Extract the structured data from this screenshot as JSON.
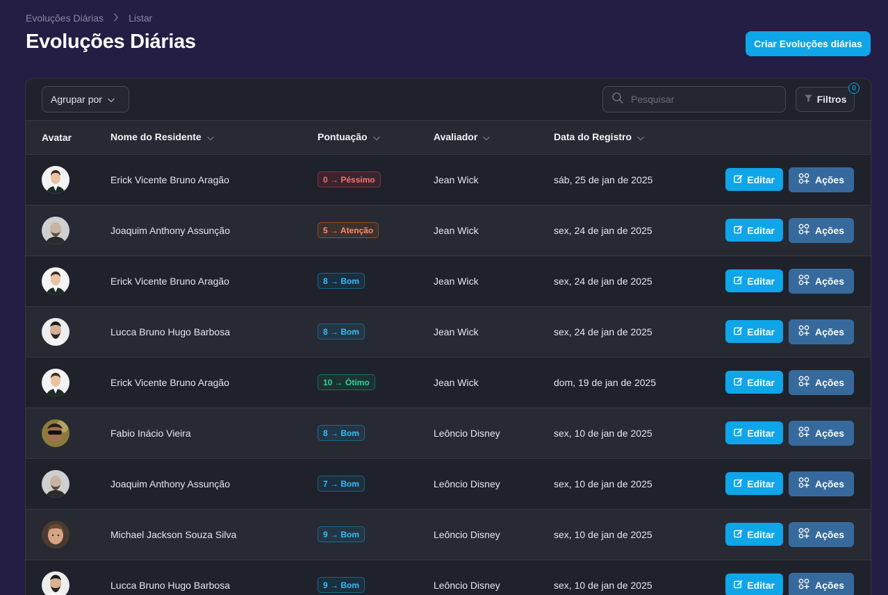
{
  "breadcrumb": {
    "parent": "Evoluções Diárias",
    "current": "Listar"
  },
  "page": {
    "title": "Evoluções Diárias",
    "create_label": "Criar Evoluções diárias"
  },
  "toolbar": {
    "group_label": "Agrupar por",
    "search_placeholder": "Pesquisar",
    "filter_label": "Filtros",
    "filter_count": "0"
  },
  "columns": {
    "avatar": "Avatar",
    "name": "Nome do Residente",
    "score": "Pontuação",
    "evaluator": "Avaliador",
    "date": "Data do Registro"
  },
  "colors": {
    "accent": "#0ea5e9",
    "actions": "#376a9c",
    "bad": "#f87171",
    "warn": "#fb8a6a",
    "good": "#38bdf8",
    "great": "#34d399"
  },
  "row_actions": {
    "edit_label": "Editar",
    "actions_label": "Ações"
  },
  "rows": [
    {
      "name": "Erick Vicente Bruno Aragão",
      "score": "0 → Péssimo",
      "level": "bad",
      "evaluator": "Jean Wick",
      "date": "sáb, 25 de jan de 2025",
      "avatar": "suit"
    },
    {
      "name": "Joaquim Anthony Assunção",
      "score": "5 → Atenção",
      "level": "warn",
      "evaluator": "Jean Wick",
      "date": "sex, 24 de jan de 2025",
      "avatar": "bald"
    },
    {
      "name": "Erick Vicente Bruno Aragão",
      "score": "8 → Bom",
      "level": "good",
      "evaluator": "Jean Wick",
      "date": "sex, 24 de jan de 2025",
      "avatar": "suit"
    },
    {
      "name": "Lucca Bruno Hugo Barbosa",
      "score": "8 → Bom",
      "level": "good",
      "evaluator": "Jean Wick",
      "date": "sex, 24 de jan de 2025",
      "avatar": "beard"
    },
    {
      "name": "Erick Vicente Bruno Aragão",
      "score": "10 → Ótimo",
      "level": "great",
      "evaluator": "Jean Wick",
      "date": "dom, 19 de jan de 2025",
      "avatar": "suit"
    },
    {
      "name": "Fabio Inácio Vieira",
      "score": "8 → Bom",
      "level": "good",
      "evaluator": "Leôncio Disney",
      "date": "sex, 10 de jan de 2025",
      "avatar": "sunglasses"
    },
    {
      "name": "Joaquim Anthony Assunção",
      "score": "7 → Bom",
      "level": "good",
      "evaluator": "Leôncio Disney",
      "date": "sex, 10 de jan de 2025",
      "avatar": "bald"
    },
    {
      "name": "Michael Jackson Souza Silva",
      "score": "9 → Bom",
      "level": "good",
      "evaluator": "Leôncio Disney",
      "date": "sex, 10 de jan de 2025",
      "avatar": "young"
    },
    {
      "name": "Lucca Bruno Hugo Barbosa",
      "score": "9 → Bom",
      "level": "good",
      "evaluator": "Leôncio Disney",
      "date": "sex, 10 de jan de 2025",
      "avatar": "beard"
    }
  ]
}
